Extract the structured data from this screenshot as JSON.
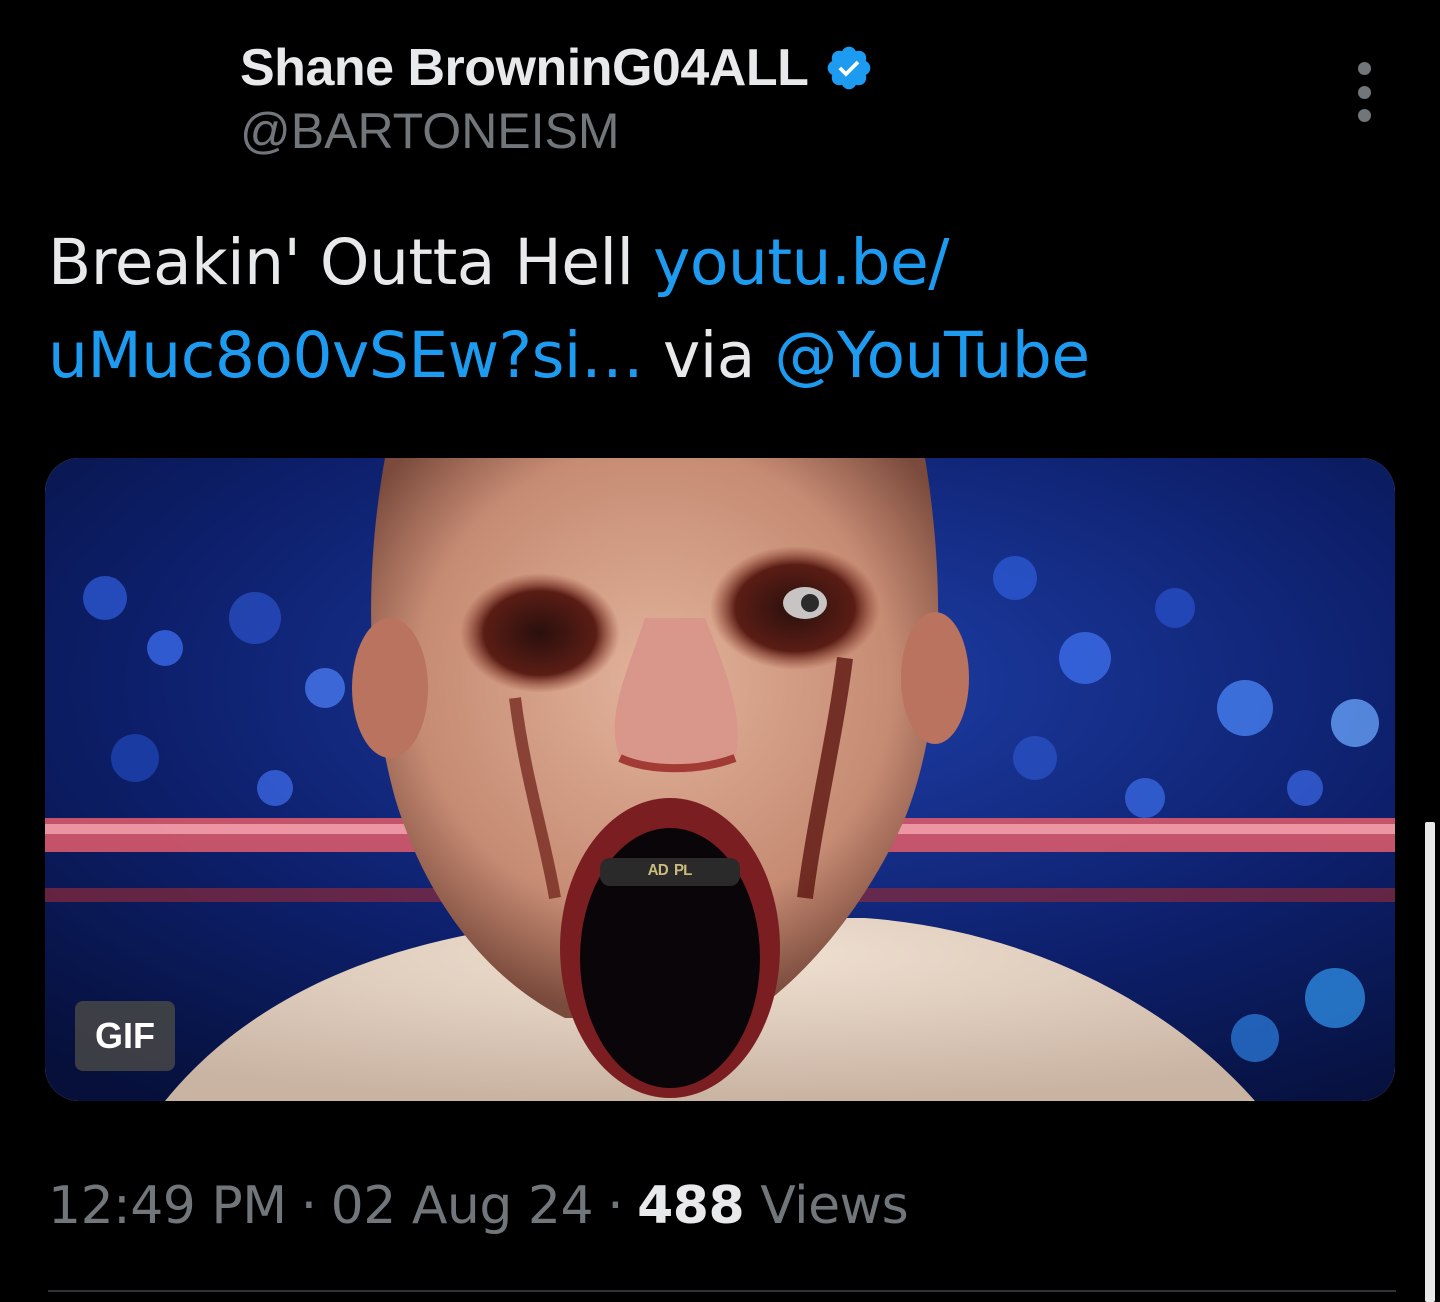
{
  "author": {
    "display_name": "Shane BrowninG04ALL",
    "handle": "@BARTONEISM",
    "verified_icon": "verified-badge-icon"
  },
  "more_icon": "more-vertical-icon",
  "tweet": {
    "text": "Breakin' Outta Hell",
    "link_text": "youtu.be/ uMuc8o0vSEw?si…",
    "via_text": "via",
    "mention": "@YouTube"
  },
  "media": {
    "badge": "GIF"
  },
  "meta": {
    "time": "12:49 PM",
    "separator": "·",
    "date": "02 Aug 24",
    "views_count": "488",
    "views_label": "Views"
  },
  "colors": {
    "background": "#000000",
    "text": "#e7e9ea",
    "secondary": "#71767b",
    "link": "#1d9bf0"
  }
}
